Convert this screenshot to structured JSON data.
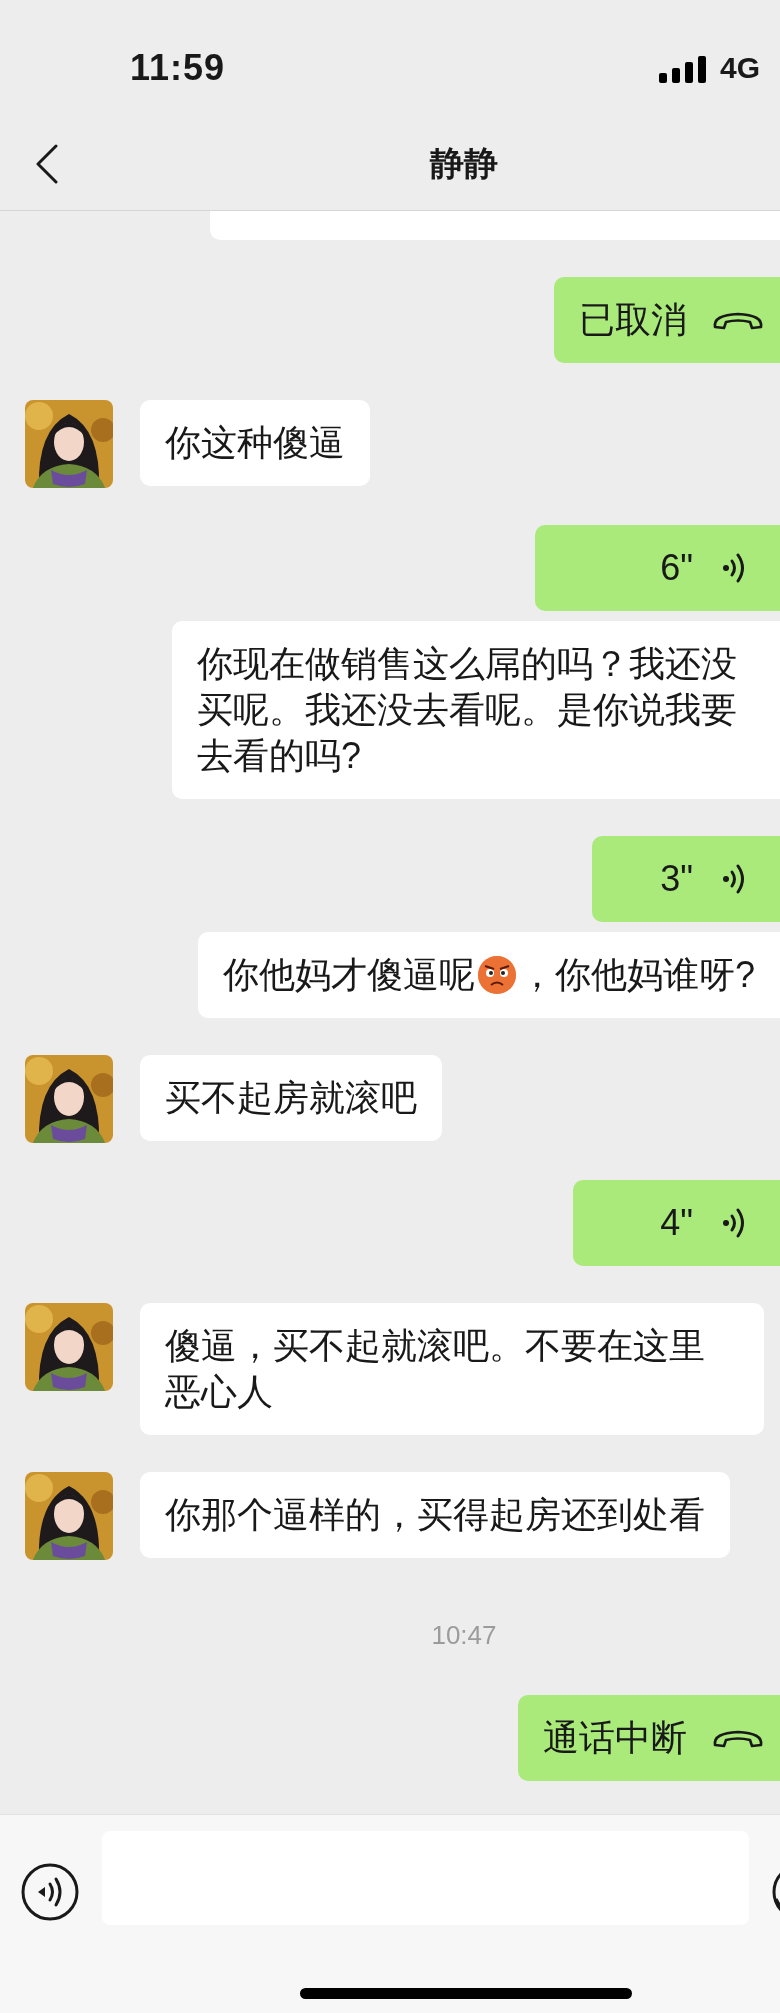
{
  "status_bar": {
    "time": "11:59",
    "network": "4G"
  },
  "nav": {
    "title": "静静"
  },
  "messages": [
    {
      "outgoing": true,
      "kind": "transcript_fragment"
    },
    {
      "outgoing": true,
      "kind": "call",
      "text": "已取消"
    },
    {
      "outgoing": false,
      "kind": "text",
      "text": "你这种傻逼"
    },
    {
      "outgoing": true,
      "kind": "voice",
      "duration": "6\""
    },
    {
      "outgoing": true,
      "kind": "transcript",
      "parts": [
        {
          "kind": "text",
          "text": "你现在做销售这么屌的吗？我还没买呢。我还没去看呢。是你说我要去看的吗?"
        }
      ]
    },
    {
      "outgoing": true,
      "kind": "voice",
      "duration": "3\""
    },
    {
      "outgoing": true,
      "kind": "transcript",
      "parts": [
        {
          "kind": "text",
          "text": "你他妈才傻逼呢"
        },
        {
          "kind": "emoji"
        },
        {
          "kind": "text",
          "text": "，你他妈谁呀?"
        }
      ]
    },
    {
      "outgoing": false,
      "kind": "text",
      "text": "买不起房就滚吧"
    },
    {
      "outgoing": true,
      "kind": "voice",
      "duration": "4\""
    },
    {
      "outgoing": false,
      "kind": "text",
      "text": "傻逼，买不起就滚吧。不要在这里恶心人"
    },
    {
      "outgoing": false,
      "kind": "text",
      "text": "你那个逼样的，买得起房还到处看"
    },
    {
      "kind": "time",
      "text": "10:47"
    },
    {
      "outgoing": true,
      "kind": "call",
      "text": "通话中断"
    }
  ]
}
